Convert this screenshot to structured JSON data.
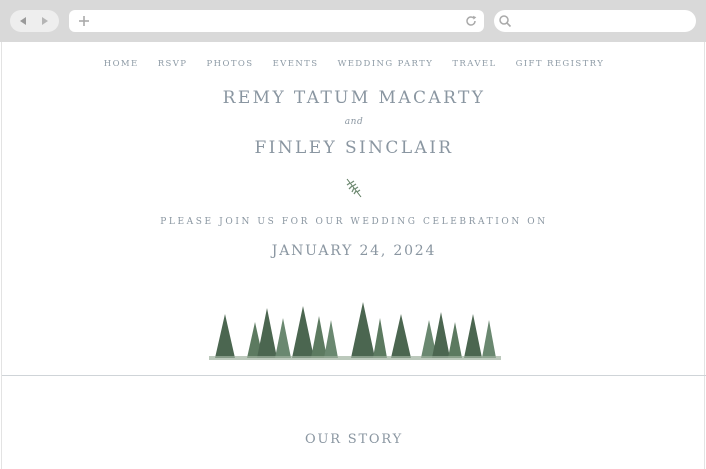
{
  "browser": {
    "icons": [
      "back-arrow-icon",
      "forward-arrow-icon",
      "plus-icon",
      "reload-icon",
      "search-icon"
    ],
    "url_value": "",
    "search_value": ""
  },
  "nav": [
    "HOME",
    "RSVP",
    "PHOTOS",
    "EVENTS",
    "WEDDING PARTY",
    "TRAVEL",
    "GIFT REGISTRY"
  ],
  "hero": {
    "name1": "REMY TATUM MACARTY",
    "and": "and",
    "name2": "FINLEY SINCLAIR",
    "invite": "PLEASE JOIN US FOR OUR WEDDING CELEBRATION ON",
    "date": "JANUARY 24, 2024"
  },
  "section": {
    "title": "OUR STORY"
  },
  "colors": {
    "text": "#8a96a1",
    "chrome": "#d9d9d9",
    "tree_dark": "#3f5a45",
    "tree_mid": "#6f8b73"
  }
}
